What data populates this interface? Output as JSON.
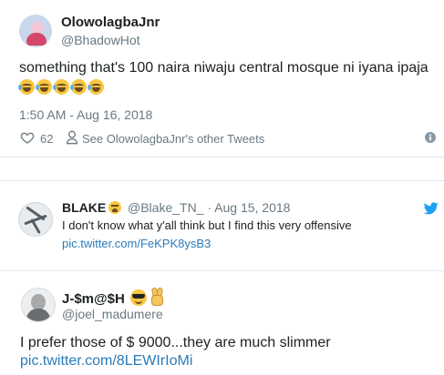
{
  "tweet": {
    "author_name": "OlowolagbaJnr",
    "author_handle": "@BhadowHot",
    "text": "something that's 100 naira niwaju central mosque ni iyana ipaja",
    "emoji_count": 5,
    "emoji_icon": "face-with-tears-of-joy-icon",
    "timestamp": "1:50 AM - Aug 16, 2018",
    "like_count": "62",
    "other_tweets_label": "See OlowolagbaJnr's other Tweets"
  },
  "quoted_tweet": {
    "author_name": "BLAKE",
    "author_handle": "@Blake_TN_",
    "separator": "·",
    "date": "Aug 15, 2018",
    "text": "I don't know what y'all think but I find this very offensive",
    "link": "pic.twitter.com/FeKPK8ysB3"
  },
  "reply_tweet": {
    "author_name": "J-$m@$H",
    "author_handle": "@joel_madumere",
    "text": "I prefer those of $ 9000...they are much slimmer",
    "link": "pic.twitter.com/8LEWIrIoMi"
  },
  "colors": {
    "link": "#2b7bb9",
    "secondary_text": "#697882",
    "twitter_blue": "#1da1f2",
    "divider": "#e1e8ed"
  }
}
